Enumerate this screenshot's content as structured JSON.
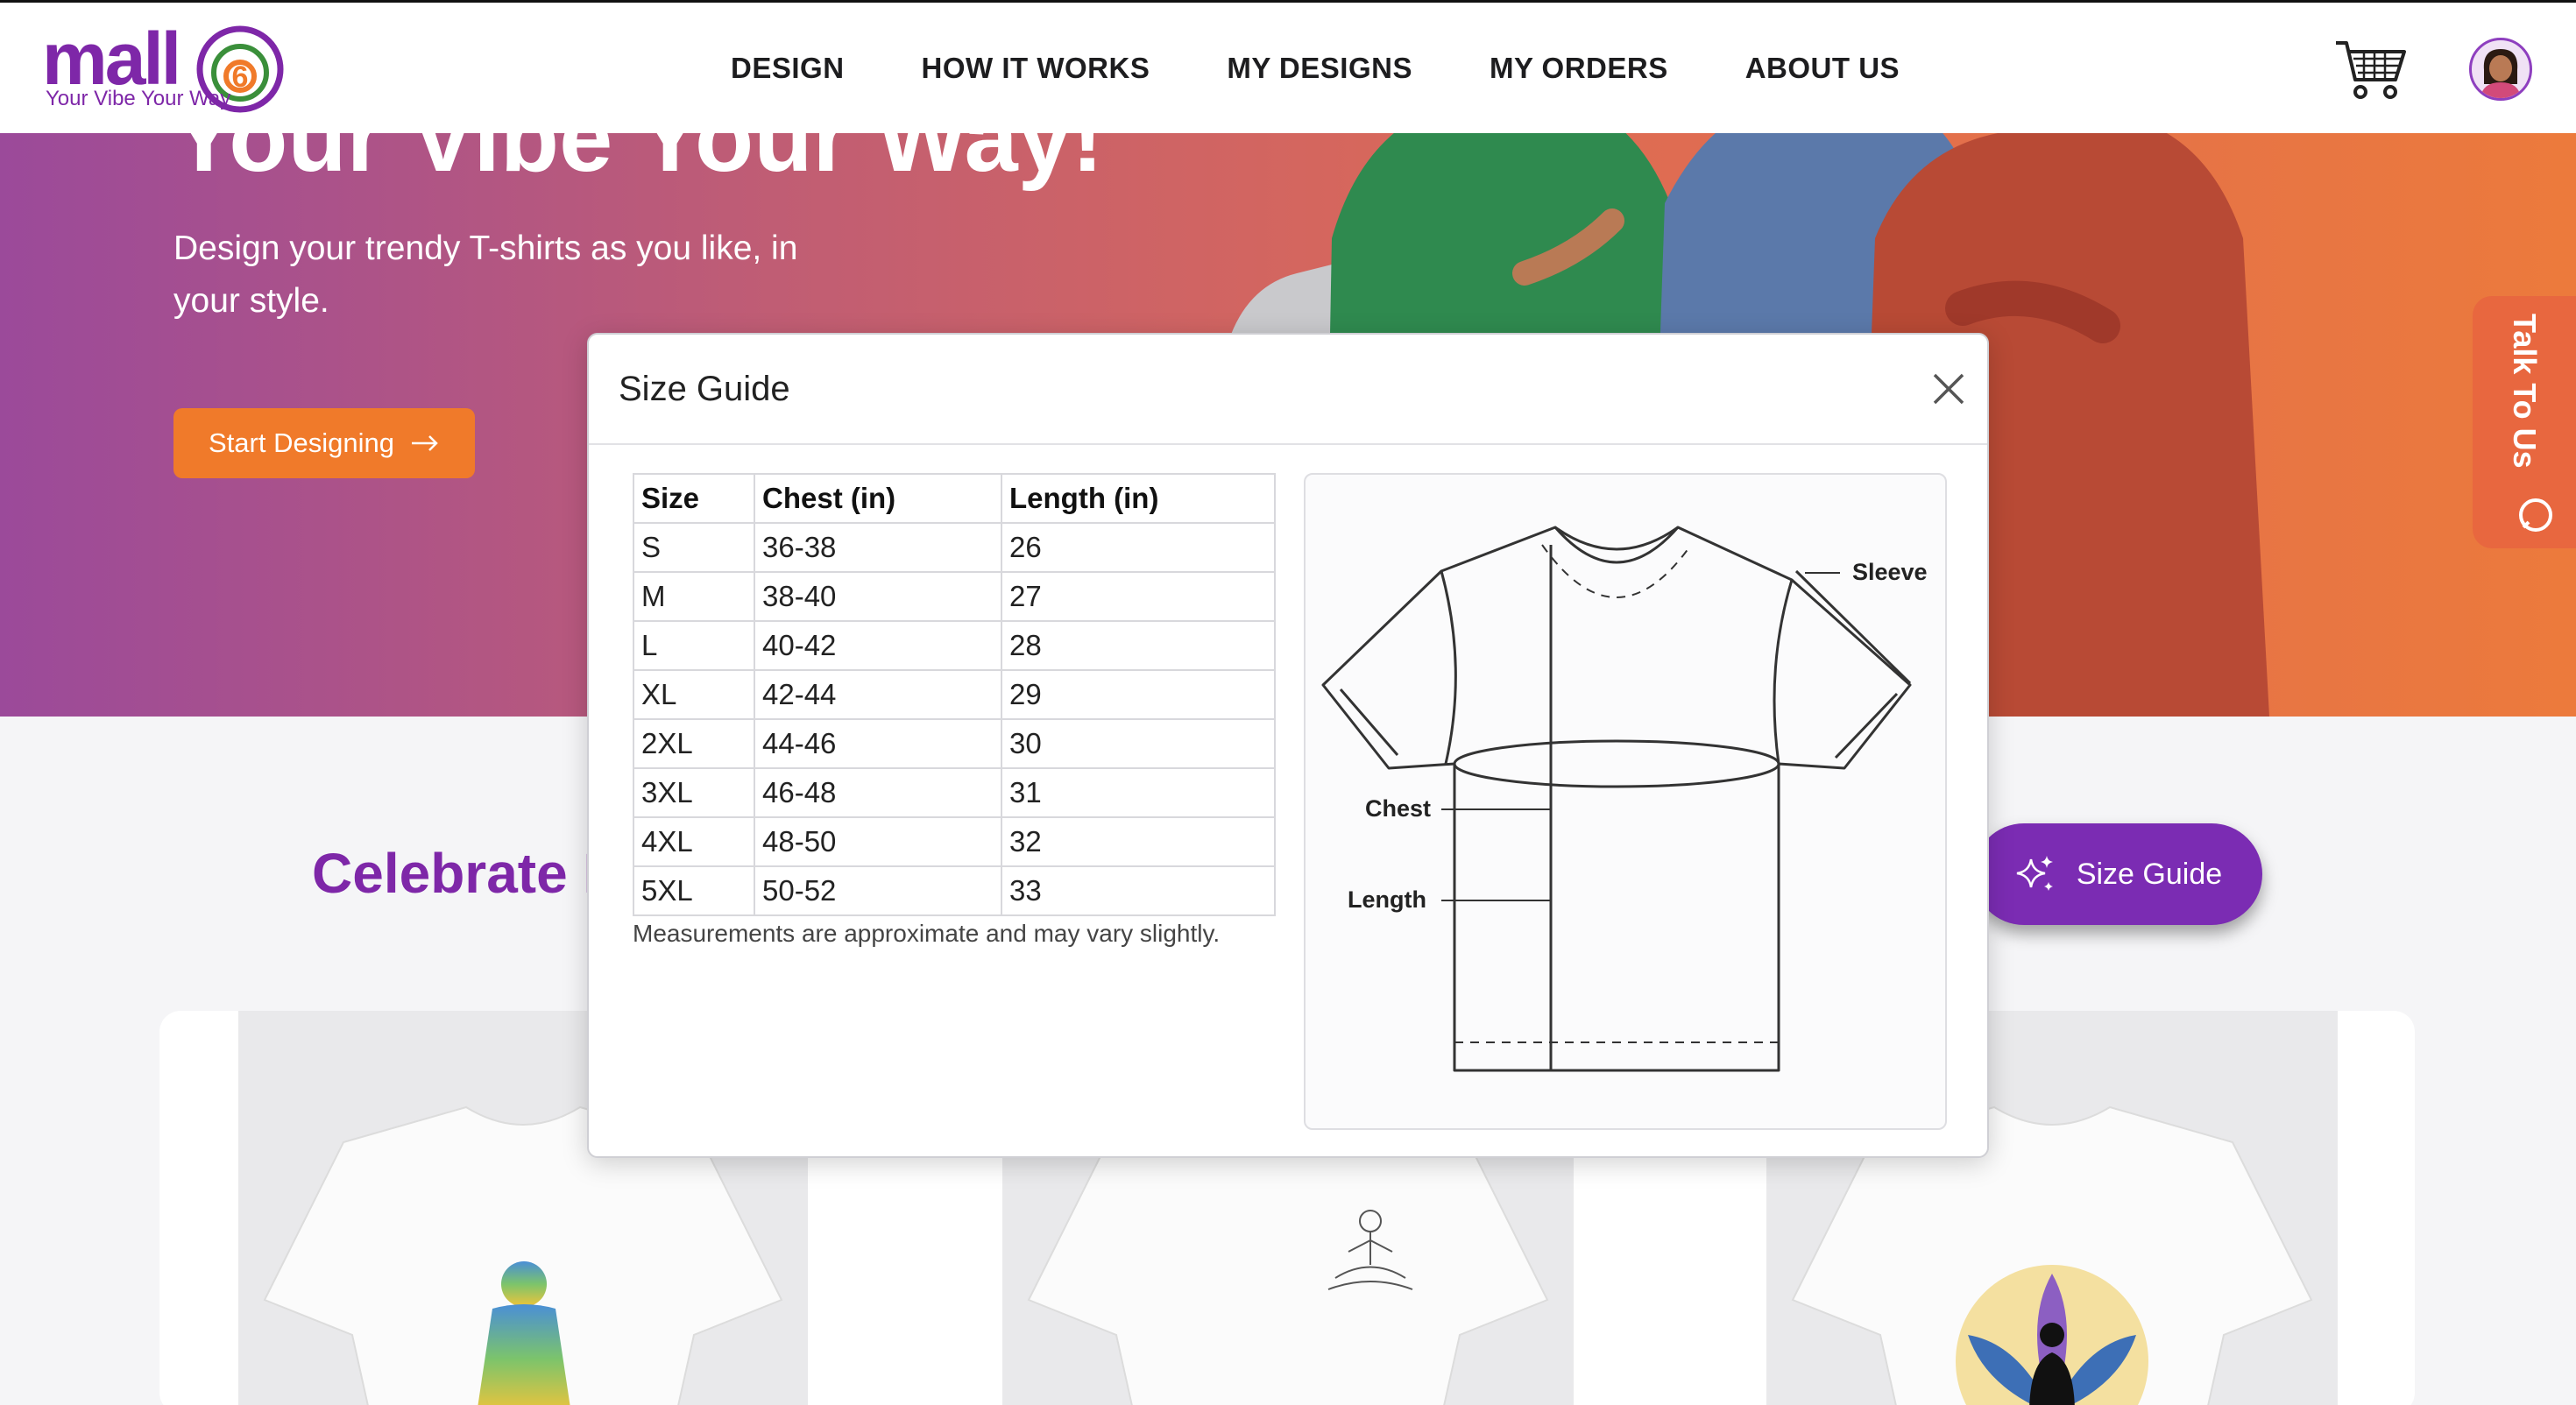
{
  "header": {
    "logo_word": "mall",
    "logo_digit": "6",
    "logo_tagline": "Your Vibe Your Way",
    "nav": [
      "DESIGN",
      "HOW IT WORKS",
      "MY DESIGNS",
      "MY ORDERS",
      "ABOUT US"
    ],
    "icons": [
      "shopping-cart-icon",
      "user-avatar"
    ]
  },
  "hero": {
    "title": "Your Vibe Your Way!",
    "subtitle": "Design your trendy T-shirts as you like, in your style.",
    "cta_label": "Start Designing",
    "cta_icon": "arrow-right-icon"
  },
  "talk_to_us": {
    "label": "Talk To Us",
    "icon": "chat-icon"
  },
  "section": {
    "title": "Celebrate I"
  },
  "size_guide_button": {
    "label": "Size Guide",
    "icon": "sparkle-icon"
  },
  "modal": {
    "title": "Size Guide",
    "close_icon": "close-icon",
    "table": {
      "headers": [
        "Size",
        "Chest (in)",
        "Length (in)"
      ],
      "rows": [
        [
          "S",
          "36-38",
          "26"
        ],
        [
          "M",
          "38-40",
          "27"
        ],
        [
          "L",
          "40-42",
          "28"
        ],
        [
          "XL",
          "42-44",
          "29"
        ],
        [
          "2XL",
          "44-46",
          "30"
        ],
        [
          "3XL",
          "46-48",
          "31"
        ],
        [
          "4XL",
          "48-50",
          "32"
        ],
        [
          "5XL",
          "50-52",
          "33"
        ]
      ]
    },
    "note": "Measurements are approximate and may vary slightly.",
    "diagram_labels": {
      "sleeve": "Sleeve",
      "chest": "Chest",
      "length": "Length"
    }
  },
  "colors": {
    "brand_purple": "#7e27a8",
    "cta_orange": "#f07a2a",
    "talk_orange": "#e8673f",
    "pill_purple": "#7b2cb3"
  }
}
